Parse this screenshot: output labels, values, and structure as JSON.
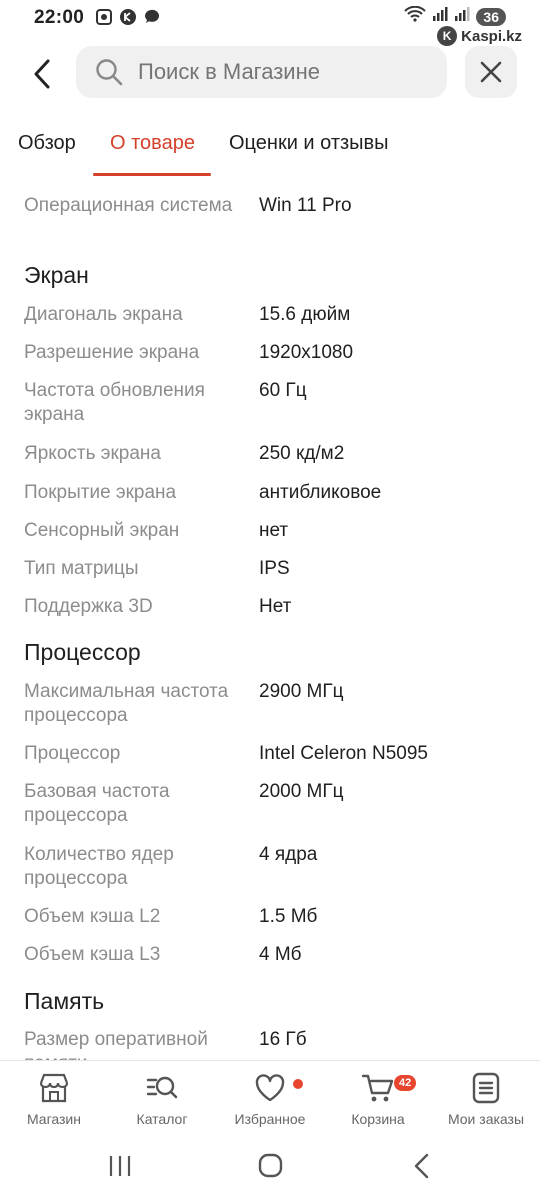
{
  "status_bar": {
    "time": "22:00",
    "battery": "36",
    "watermark": "Kaspi.kz"
  },
  "header": {
    "search_placeholder": "Поиск в Магазине"
  },
  "tabs": [
    {
      "label": "Обзор",
      "active": false
    },
    {
      "label": "О товаре",
      "active": true
    },
    {
      "label": "Оценки и отзывы",
      "active": false
    }
  ],
  "specs": {
    "os": {
      "label": "Операционная система",
      "value": "Win 11 Pro"
    },
    "screen": {
      "title": "Экран",
      "rows": [
        {
          "label": "Диагональ экрана",
          "value": "15.6 дюйм"
        },
        {
          "label": "Разрешение экрана",
          "value": "1920x1080"
        },
        {
          "label": "Частота обновления экрана",
          "value": "60 Гц"
        },
        {
          "label": "Яркость экрана",
          "value": "250 кд/м2"
        },
        {
          "label": "Покрытие экрана",
          "value": "антибликовое"
        },
        {
          "label": "Сенсорный экран",
          "value": "нет"
        },
        {
          "label": "Тип матрицы",
          "value": "IPS"
        },
        {
          "label": "Поддержка 3D",
          "value": "Нет"
        }
      ]
    },
    "processor": {
      "title": "Процессор",
      "rows": [
        {
          "label": "Максимальная частота процессора",
          "value": "2900 МГц"
        },
        {
          "label": "Процессор",
          "value": "Intel Celeron N5095"
        },
        {
          "label": "Базовая частота процессора",
          "value": "2000 МГц"
        },
        {
          "label": "Количество ядер процессора",
          "value": "4 ядра"
        },
        {
          "label": "Объем кэша L2",
          "value": "1.5 Мб"
        },
        {
          "label": "Объем кэша L3",
          "value": "4 Мб"
        }
      ]
    },
    "memory": {
      "title": "Память",
      "rows": [
        {
          "label": "Размер оперативной памяти",
          "value": "16 Гб"
        }
      ]
    }
  },
  "bottom_nav": [
    {
      "label": "Магазин",
      "icon": "store-icon"
    },
    {
      "label": "Каталог",
      "icon": "catalog-search-icon"
    },
    {
      "label": "Избранное",
      "icon": "heart-icon"
    },
    {
      "label": "Корзина",
      "icon": "cart-icon",
      "badge": "42"
    },
    {
      "label": "Мои заказы",
      "icon": "orders-icon"
    }
  ],
  "colors": {
    "accent": "#d4402a",
    "badge": "#e8452f",
    "label_gray": "#8c8c8c"
  }
}
